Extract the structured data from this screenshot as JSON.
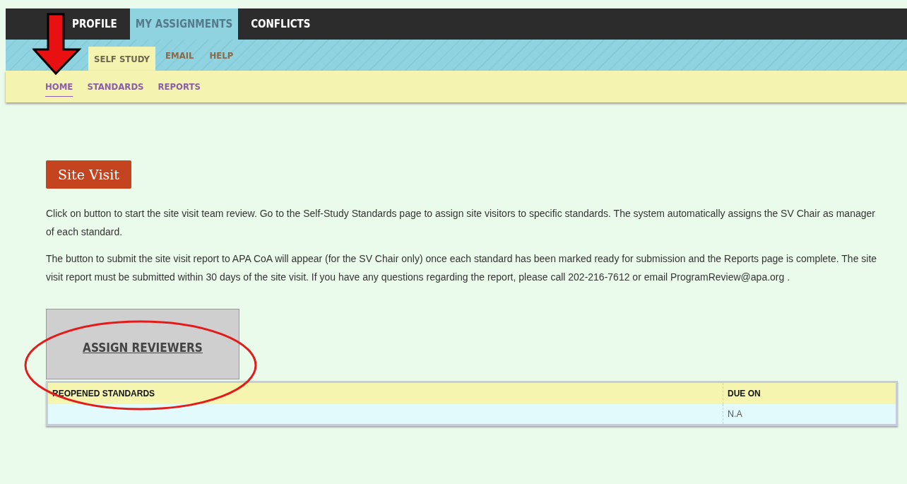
{
  "main_nav": [
    {
      "label": "PROFILE",
      "selected": false
    },
    {
      "label": "MY ASSIGNMENTS",
      "selected": true
    },
    {
      "label": "CONFLICTS",
      "selected": false
    }
  ],
  "sub_nav": [
    {
      "label": "SELF STUDY",
      "selected": true
    },
    {
      "label": "EMAIL",
      "selected": false
    },
    {
      "label": "HELP",
      "selected": false
    }
  ],
  "page_nav": [
    {
      "label": "HOME",
      "selected": true
    },
    {
      "label": "STANDARDS",
      "selected": false
    },
    {
      "label": "REPORTS",
      "selected": false
    }
  ],
  "heading": "Site Visit",
  "paragraphs": [
    "Click on button to start the site visit team review. Go to the Self-Study Standards page to assign site visitors to specific standards. The system automatically assigns the SV Chair as manager of each standard.",
    "The button to submit the site visit report to APA CoA will appear (for the SV Chair only) once each standard has been marked ready for submission and the Reports page is complete. The site visit report must be submitted within 30 days of the site visit. If you have any questions regarding the report, please call 202-216-7612 or email ProgramReview@apa.org ."
  ],
  "assign_button": "ASSIGN REVIEWERS",
  "table": {
    "columns": [
      "REOPENED STANDARDS",
      "DUE ON"
    ],
    "rows": [
      [
        "",
        "N.A"
      ]
    ]
  }
}
